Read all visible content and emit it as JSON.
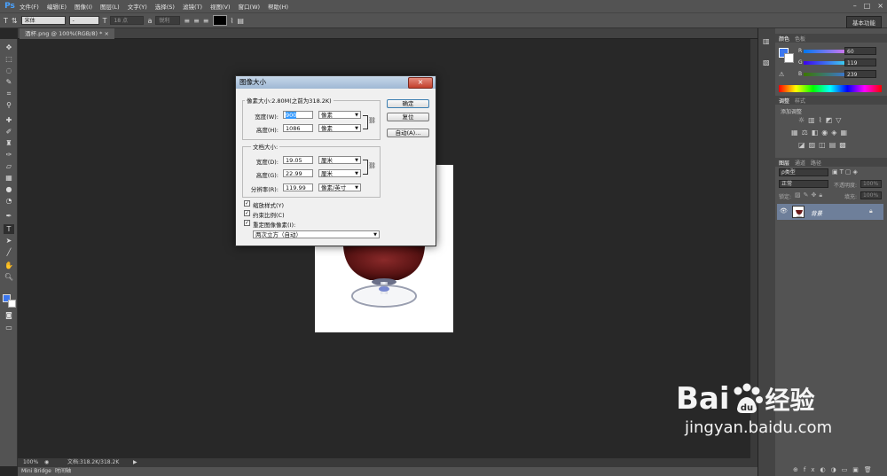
{
  "app": {
    "logo": "Ps"
  },
  "menu": [
    "文件(F)",
    "编辑(E)",
    "图像(I)",
    "图层(L)",
    "文字(Y)",
    "选择(S)",
    "滤镜(T)",
    "视图(V)",
    "窗口(W)",
    "帮助(H)"
  ],
  "window_controls": [
    "–",
    "□",
    "×"
  ],
  "options_bar": {
    "tool_icon": "T",
    "font_family": "宋体",
    "font_style": "-",
    "font_size": "18 点",
    "anti_alias": "锐利",
    "color": "#000000",
    "workspace": "基本功能"
  },
  "document_tab": {
    "label": "酒杯.png @ 100%(RGB/8) *",
    "close": "×"
  },
  "status": {
    "zoom": "100%",
    "doc_info": "文档:318.2K/318.2K"
  },
  "bottom_tabs": [
    "Mini Bridge",
    "时间轴"
  ],
  "color_panel": {
    "tabs": [
      "颜色",
      "色板"
    ],
    "r_label": "R",
    "g_label": "G",
    "b_label": "B",
    "r": "60",
    "g": "119",
    "b": "239",
    "fg_color": "#3c77ef"
  },
  "adjust_panel": {
    "tabs": [
      "调整",
      "样式"
    ],
    "add_label": "添加调整"
  },
  "layers_panel": {
    "tabs": [
      "图层",
      "通道",
      "路径"
    ],
    "kind": "ρ类型",
    "blend_mode": "正常",
    "opacity_label": "不透明度:",
    "opacity": "100%",
    "lock_label": "锁定:",
    "fill_label": "填充:",
    "fill": "100%",
    "layer_name": "背景"
  },
  "dialog": {
    "title": "图像大小",
    "close": "×",
    "pixel_dimensions": "像素大小:2.80M(之前为318.2K)",
    "width_label": "宽度(W):",
    "width_value": "900",
    "width_unit": "像素",
    "height_label": "高度(H):",
    "height_value": "1086",
    "height_unit": "像素",
    "doc_size_title": "文档大小:",
    "doc_width_label": "宽度(D):",
    "doc_width_value": "19.05",
    "doc_width_unit": "厘米",
    "doc_height_label": "高度(G):",
    "doc_height_value": "22.99",
    "doc_height_unit": "厘米",
    "resolution_label": "分辨率(R):",
    "resolution_value": "119.99",
    "resolution_unit": "像素/英寸",
    "ok": "确定",
    "reset": "复位",
    "auto": "自动(A)...",
    "scale_styles": "缩放样式(Y)",
    "constrain": "约束比例(C)",
    "resample": "重定图像像素(I):",
    "resample_method": "两次立方（自动）",
    "checked_mark": "✓"
  },
  "watermark": {
    "brand": "Bai",
    "brand_cn": "经验",
    "url": "jingyan.baidu.com"
  }
}
